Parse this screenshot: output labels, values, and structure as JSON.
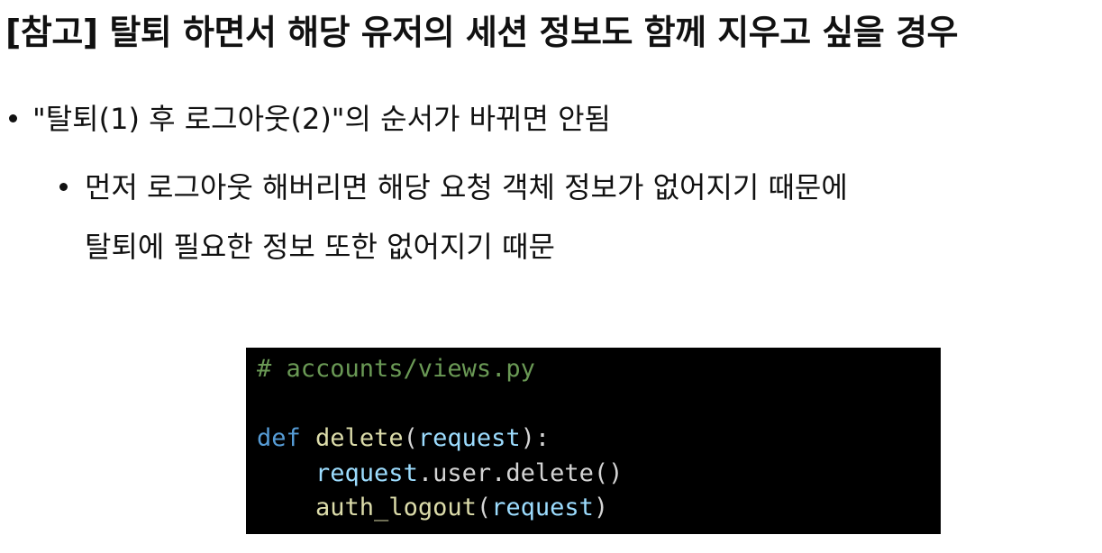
{
  "title": "[참고] 탈퇴 하면서 해당 유저의 세션 정보도 함께 지우고 싶을 경우",
  "bullets": [
    {
      "text": "\"탈퇴(1) 후 로그아웃(2)\"의 순서가 바뀌면 안됨"
    },
    {
      "text": "먼저 로그아웃 해버리면 해당 요청 객체 정보가 없어지기 때문에"
    },
    {
      "text": "탈퇴에 필요한 정보 또한 없어지기 때문"
    }
  ],
  "code": {
    "comment": "# accounts/views.py",
    "def_keyword": "def",
    "func_name": "delete",
    "open_paren": "(",
    "param": "request",
    "close_paren_colon": "):",
    "line3_indent": "    ",
    "line3_obj": "request",
    "line3_rest": ".user.delete()",
    "line4_indent": "    ",
    "line4_func": "auth_logout",
    "line4_open": "(",
    "line4_arg": "request",
    "line4_close": ")"
  },
  "colors": {
    "code_background": "#000000",
    "comment": "#6a9955",
    "keyword": "#569cd6",
    "function": "#dcdcaa",
    "parameter": "#9cdcfe",
    "plain": "#d4d4d4"
  }
}
